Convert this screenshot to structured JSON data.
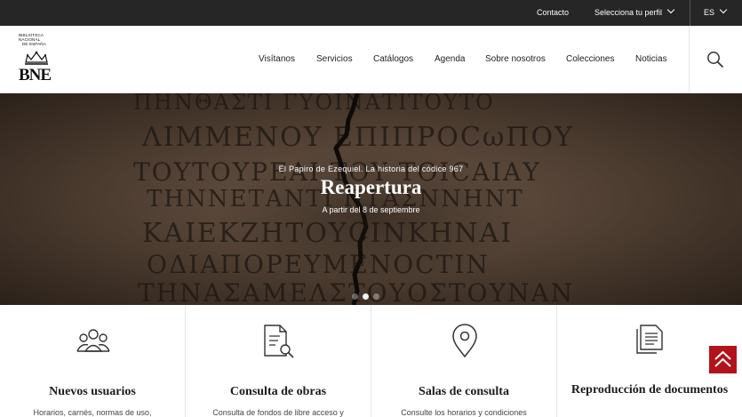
{
  "topbar": {
    "contact": "Contacto",
    "profile": "Selecciona tu perfil",
    "language": "ES"
  },
  "logo": {
    "line1": "BIBLIOTECA",
    "line2": "NACIONAL",
    "line3": "DE ESPAÑA",
    "acronym": "BNE"
  },
  "nav": {
    "items": [
      "Visítanos",
      "Servicios",
      "Catálogos",
      "Agenda",
      "Sobre nosotros",
      "Colecciones",
      "Noticias"
    ]
  },
  "hero": {
    "kicker": "El Papiro de Ezequiel. La historia del códice 967",
    "title": "Reapertura",
    "subtitle": "A partir del 8 de septiembre",
    "slides": 3,
    "active_slide": 2
  },
  "cards": [
    {
      "icon": "users-icon",
      "title": "Nuevos usuarios",
      "desc": "Horarios, carnés, normas de uso,"
    },
    {
      "icon": "document-search-icon",
      "title": "Consulta de obras",
      "desc": "Consulta de fondos de libre acceso y"
    },
    {
      "icon": "map-pin-icon",
      "title": "Salas de consulta",
      "desc": "Consulte los horarios y condiciones"
    },
    {
      "icon": "documents-copy-icon",
      "title": "Reproducción de documentos",
      "desc": ""
    }
  ],
  "colors": {
    "topbar_bg": "#262626",
    "accent_red": "#b3121b",
    "text_dark": "#222222"
  }
}
